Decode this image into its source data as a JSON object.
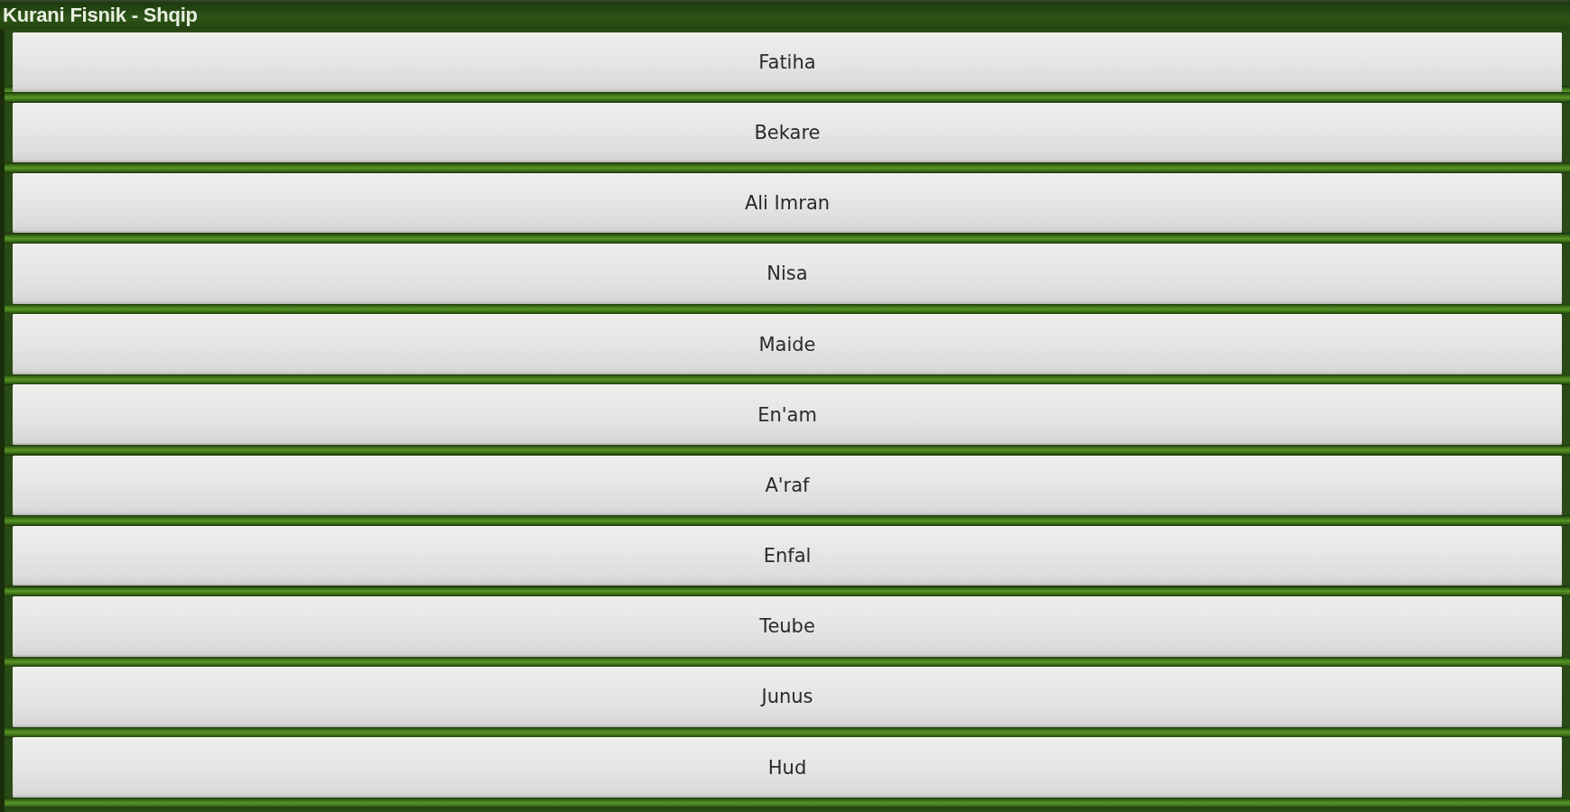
{
  "window": {
    "title": "Kurani Fisnik - Shqip"
  },
  "surah_buttons": [
    "Fatiha",
    "Bekare",
    "Ali Imran",
    "Nisa",
    "Maide",
    "En'am",
    "A'raf",
    "Enfal",
    "Teube",
    "Junus",
    "Hud"
  ]
}
